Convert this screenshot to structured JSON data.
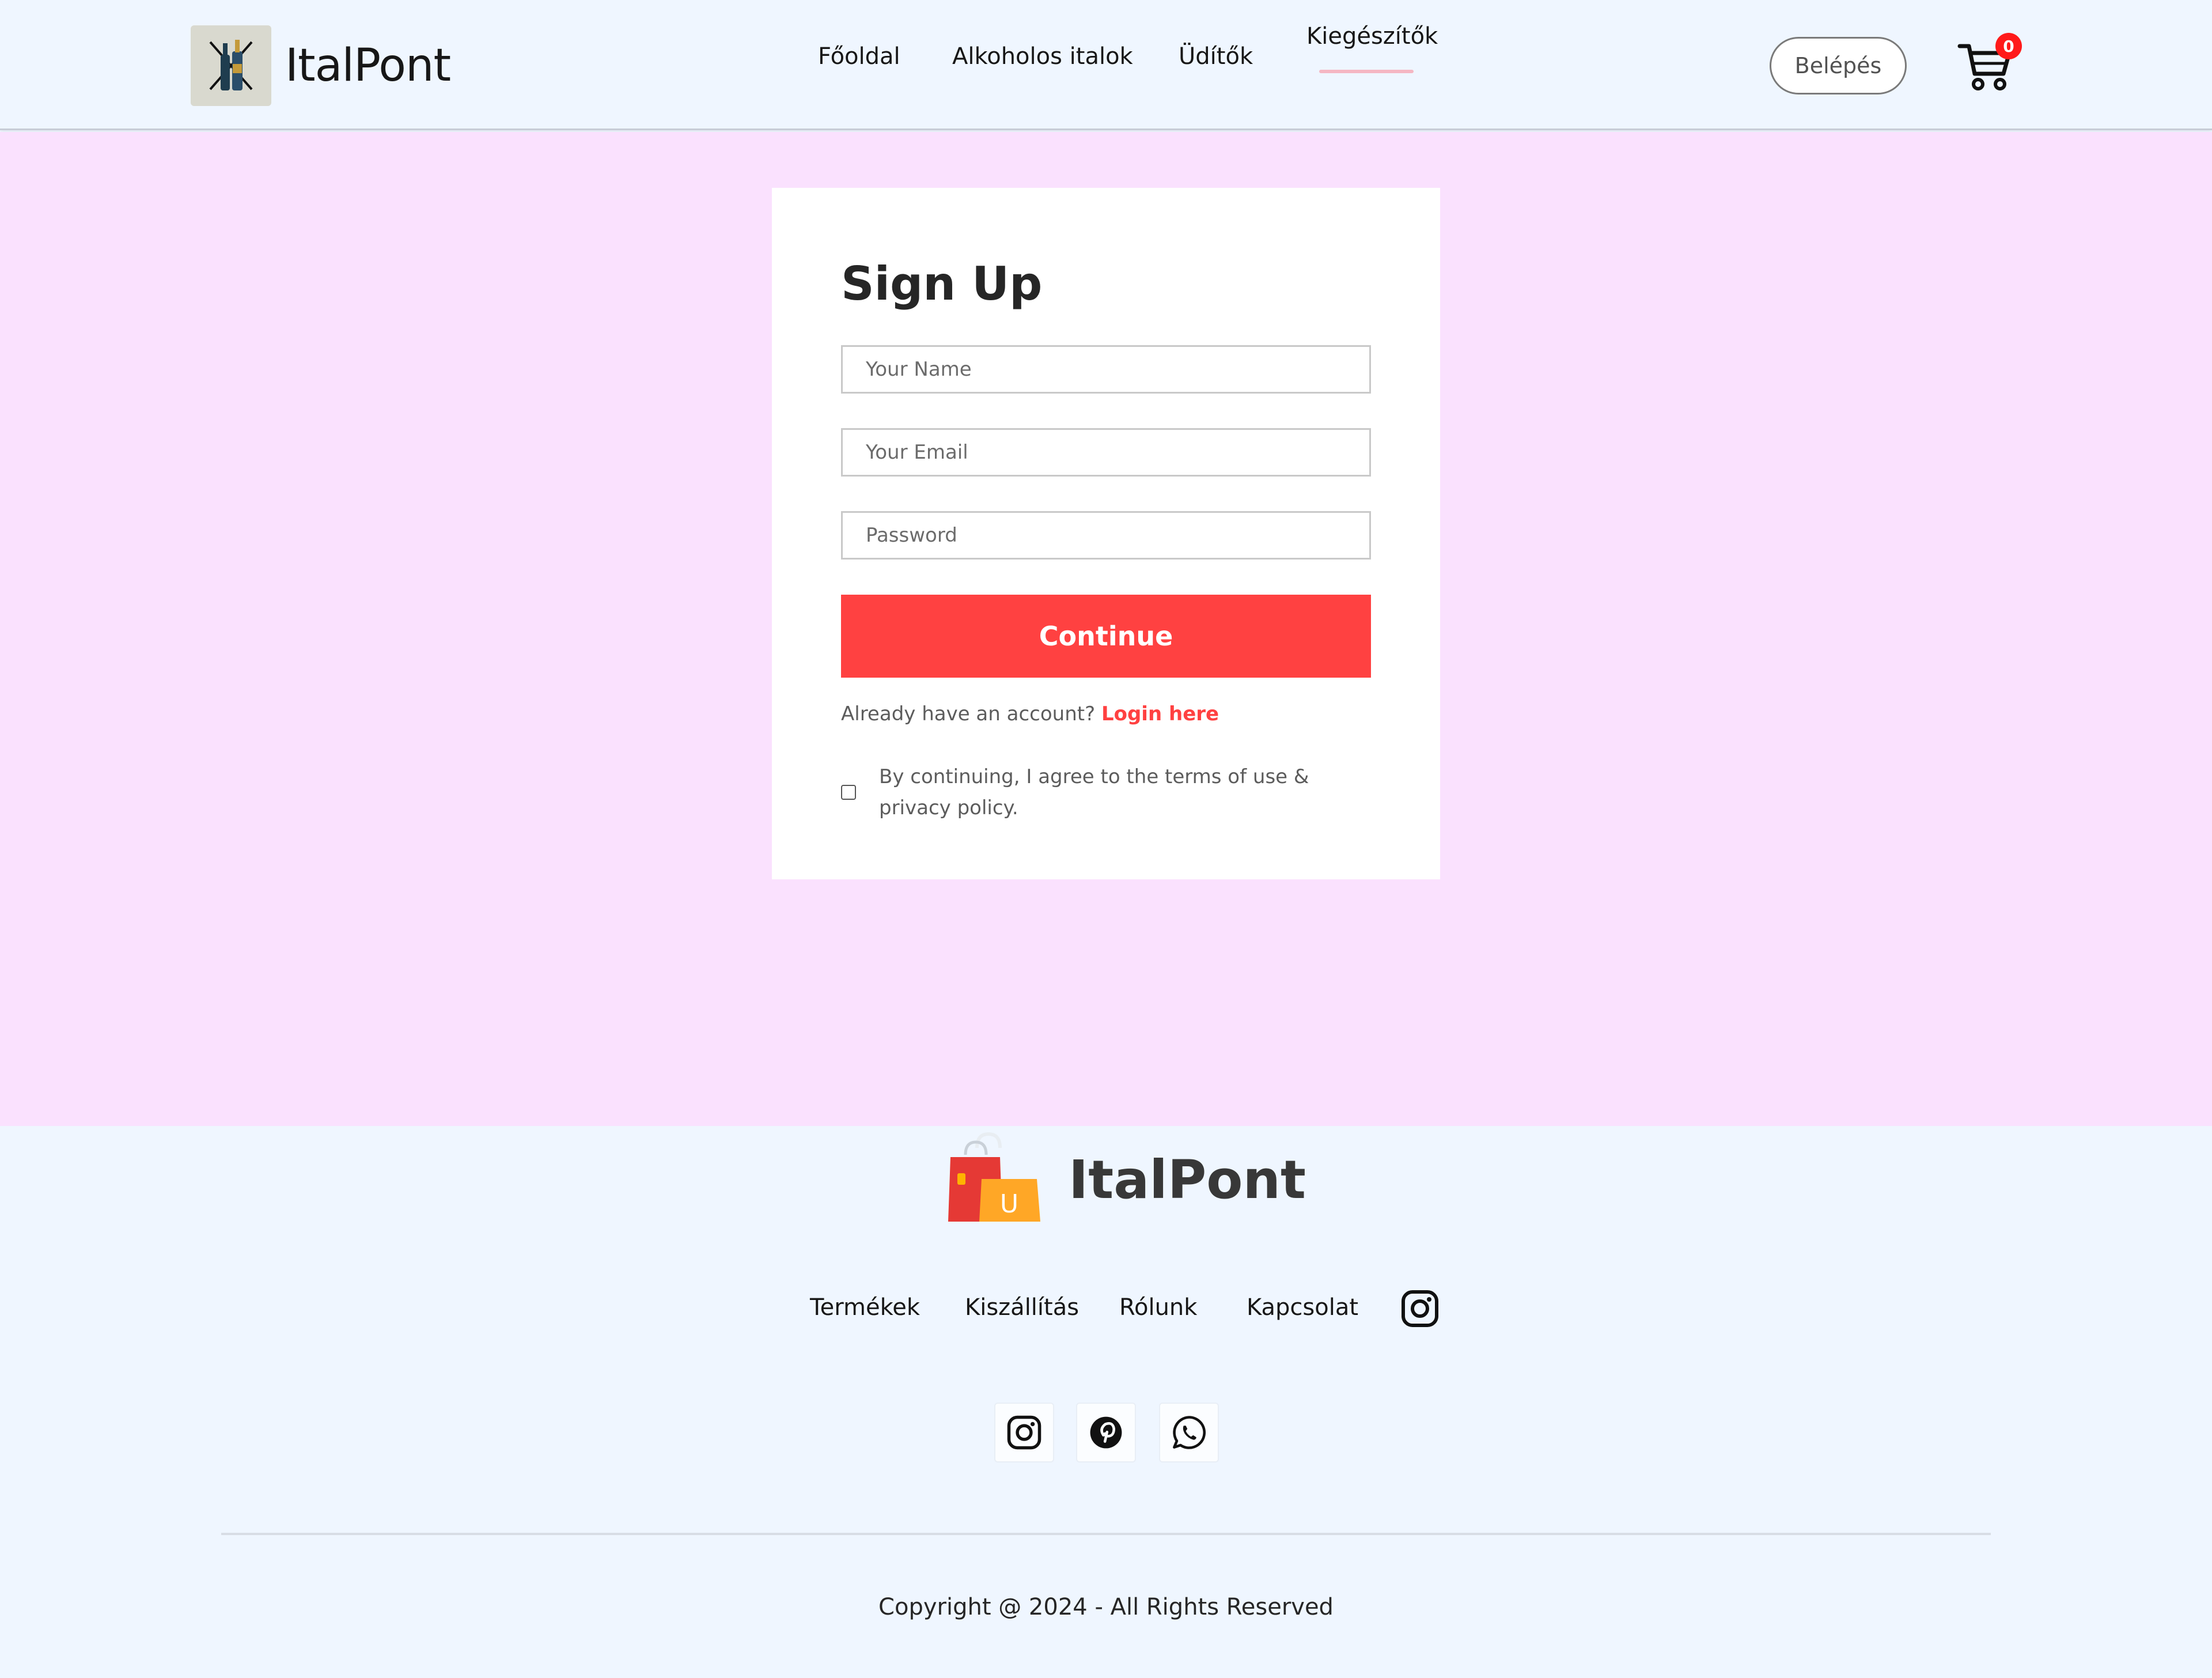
{
  "navbar": {
    "brand_name": "ItalPont",
    "menu": [
      {
        "label": "Főoldal"
      },
      {
        "label": "Alkoholos italok"
      },
      {
        "label": "Üdítők"
      },
      {
        "label": "Kiegészítők",
        "active": true
      }
    ],
    "login_label": "Belépés",
    "cart_count": "0"
  },
  "signup": {
    "title": "Sign Up",
    "name_placeholder": "Your Name",
    "email_placeholder": "Your Email",
    "password_placeholder": "Password",
    "continue_label": "Continue",
    "login_prompt": "Already have an account?",
    "login_link": "Login here",
    "agree_text": "By continuing, I agree to the terms of use & privacy policy.",
    "agree_checked": false
  },
  "footer": {
    "brand_name": "ItalPont",
    "links": [
      {
        "label": "Termékek"
      },
      {
        "label": "Kiszállítás"
      },
      {
        "label": "Rólunk"
      },
      {
        "label": "Kapcsolat"
      }
    ],
    "social": [
      {
        "icon": "instagram-icon"
      },
      {
        "icon": "pinterest-icon"
      },
      {
        "icon": "whatsapp-icon"
      }
    ],
    "copyright": "Copyright @ 2024 - All Rights Reserved"
  },
  "colors": {
    "accent": "#ff4141",
    "main_bg": "#fae1fe",
    "header_bg": "#eff6ff",
    "badge": "#ff1a1a"
  }
}
